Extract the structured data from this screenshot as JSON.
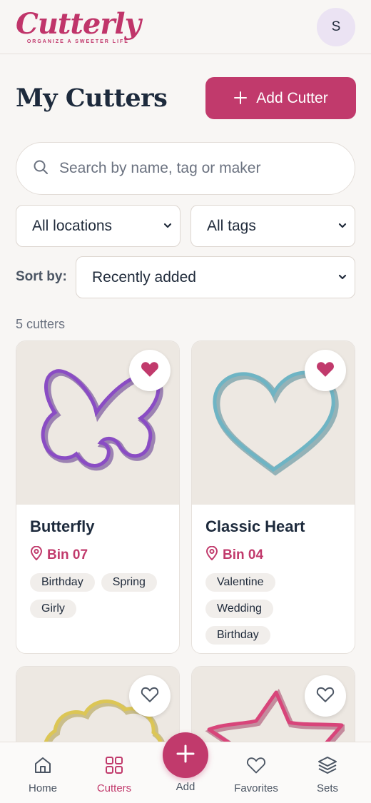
{
  "app": {
    "logo_text": "Cutterly",
    "logo_tagline": "ORGANIZE A SWEETER LIFE",
    "avatar_initial": "S"
  },
  "header": {
    "title": "My Cutters",
    "add_button_label": "Add Cutter"
  },
  "search": {
    "placeholder": "Search by name, tag or maker",
    "value": ""
  },
  "filters": {
    "location": "All locations",
    "tags": "All tags",
    "sort_label": "Sort by:",
    "sort_value": "Recently added"
  },
  "results": {
    "count_text": "5 cutters"
  },
  "cutters": [
    {
      "name": "Butterfly",
      "location": "Bin 07",
      "tags": [
        "Birthday",
        "Spring",
        "Girly"
      ],
      "favorite": true,
      "color": "#7b3fb0"
    },
    {
      "name": "Classic Heart",
      "location": "Bin 04",
      "tags": [
        "Valentine",
        "Wedding",
        "Birthday"
      ],
      "favorite": true,
      "color": "#5fa3b5"
    },
    {
      "favorite": false,
      "color": "#d9c24a"
    },
    {
      "favorite": false,
      "color": "#d8457a"
    }
  ],
  "nav": {
    "home": "Home",
    "cutters": "Cutters",
    "add": "Add",
    "favorites": "Favorites",
    "sets": "Sets"
  },
  "colors": {
    "accent": "#c13a6c",
    "background": "#f8f6f4"
  }
}
